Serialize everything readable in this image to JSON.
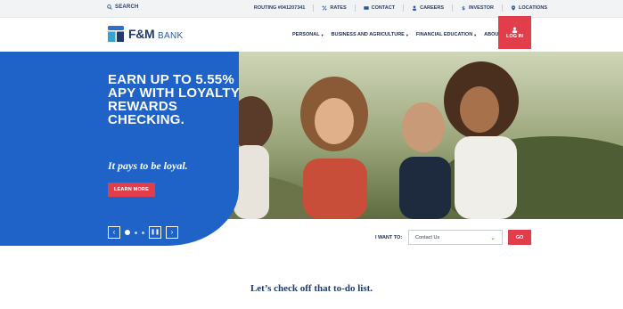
{
  "utility": {
    "search_label": "SEARCH",
    "routing": "ROUTING #041207341",
    "links": [
      "RATES",
      "CONTACT",
      "CAREERS",
      "INVESTOR",
      "LOCATIONS"
    ]
  },
  "header": {
    "logo_main": "F&M",
    "logo_sub": "BANK",
    "nav": [
      "PERSONAL",
      "BUSINESS AND AGRICULTURE",
      "FINANCIAL EDUCATION",
      "ABOUT F&M"
    ],
    "login_label": "LOG IN"
  },
  "hero": {
    "headline": "EARN UP TO 5.55% APY WITH LOYALTY REWARDS CHECKING.",
    "tagline": "It pays to be loyal.",
    "button_label": "LEARN MORE"
  },
  "want": {
    "label": "I WANT TO:",
    "selected": "Contact Us",
    "go_label": "GO"
  },
  "section": {
    "heading": "Let’s check off that to-do list."
  },
  "colors": {
    "brand_blue": "#1f63c8",
    "accent_red": "#e23d4b",
    "navy": "#1f3a6e"
  }
}
